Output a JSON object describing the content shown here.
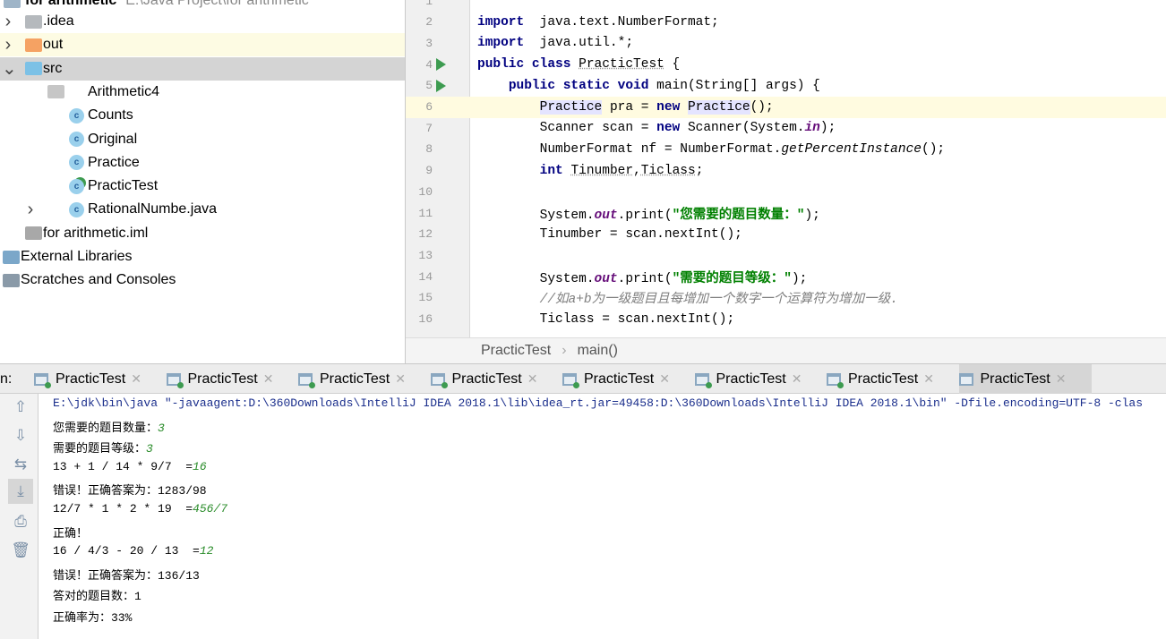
{
  "project": {
    "header": {
      "name": "for arithmetic",
      "path": "E:\\Java Project\\for arithmetic"
    },
    "items": [
      {
        "label": ".idea",
        "indent": 0,
        "expander": "chevron-right",
        "icon": "folder-gray",
        "state": ""
      },
      {
        "label": "out",
        "indent": 0,
        "expander": "chevron-right",
        "icon": "folder-orange",
        "state": "hl"
      },
      {
        "label": "src",
        "indent": 0,
        "expander": "chevron-down",
        "icon": "folder-blue",
        "state": "sel"
      },
      {
        "label": "Arithmetic4",
        "indent": 1,
        "expander": "",
        "icon": "package",
        "state": ""
      },
      {
        "label": "Counts",
        "indent": 1,
        "expander": "",
        "icon": "class",
        "state": ""
      },
      {
        "label": "Original",
        "indent": 1,
        "expander": "",
        "icon": "class",
        "state": ""
      },
      {
        "label": "Practice",
        "indent": 1,
        "expander": "",
        "icon": "class",
        "state": ""
      },
      {
        "label": "PracticTest",
        "indent": 1,
        "expander": "",
        "icon": "class-runnable",
        "state": ""
      },
      {
        "label": "RationalNumbe.java",
        "indent": 1,
        "expander": "chevron-right",
        "icon": "class",
        "state": ""
      },
      {
        "label": "for arithmetic.iml",
        "indent": 0,
        "expander": "",
        "icon": "iml-file",
        "state": ""
      },
      {
        "label": "External Libraries",
        "indent": -1,
        "expander": "",
        "icon": "libraries",
        "state": ""
      },
      {
        "label": "Scratches and Consoles",
        "indent": -1,
        "expander": "",
        "icon": "scratches",
        "state": ""
      }
    ]
  },
  "editor": {
    "current_line": 6,
    "lines": [
      {
        "n": "1",
        "run": false,
        "t": []
      },
      {
        "n": "2",
        "run": false,
        "t": [
          [
            "kw",
            "import"
          ],
          [
            "",
            "  java.text.NumberFormat;"
          ]
        ]
      },
      {
        "n": "3",
        "run": false,
        "t": [
          [
            "kw",
            "import"
          ],
          [
            "",
            "  java.util.*;"
          ]
        ]
      },
      {
        "n": "4",
        "run": true,
        "t": [
          [
            "kw",
            "public class"
          ],
          [
            "",
            " "
          ],
          [
            "ul",
            "PracticTest"
          ],
          [
            "",
            " {"
          ]
        ]
      },
      {
        "n": "5",
        "run": true,
        "t": [
          [
            "",
            "    "
          ],
          [
            "kw",
            "public static void"
          ],
          [
            "",
            " main(String[] args) {"
          ]
        ]
      },
      {
        "n": "6",
        "run": false,
        "t": [
          [
            "",
            "        "
          ],
          [
            "ref",
            "Practice"
          ],
          [
            "",
            " pra = "
          ],
          [
            "kw",
            "new"
          ],
          [
            "",
            " "
          ],
          [
            "ref",
            "Practice"
          ],
          [
            "",
            "();"
          ]
        ]
      },
      {
        "n": "7",
        "run": false,
        "t": [
          [
            "",
            "        Scanner scan = "
          ],
          [
            "kw",
            "new"
          ],
          [
            "",
            " Scanner(System."
          ],
          [
            "st",
            "in"
          ],
          [
            "",
            ");"
          ]
        ]
      },
      {
        "n": "8",
        "run": false,
        "t": [
          [
            "",
            "        NumberFormat nf = NumberFormat."
          ],
          [
            "it",
            "getPercentInstance"
          ],
          [
            "",
            "();"
          ]
        ]
      },
      {
        "n": "9",
        "run": false,
        "t": [
          [
            "",
            "        "
          ],
          [
            "kw",
            "int"
          ],
          [
            "",
            " "
          ],
          [
            "ul",
            "Tinumber"
          ],
          [
            "",
            ","
          ],
          [
            "ul",
            "Ticlass"
          ],
          [
            "",
            ";"
          ]
        ]
      },
      {
        "n": "10",
        "run": false,
        "t": []
      },
      {
        "n": "11",
        "run": false,
        "t": [
          [
            "",
            "        System."
          ],
          [
            "st",
            "out"
          ],
          [
            "",
            ".print("
          ],
          [
            "str",
            "\"您需要的题目数量：\""
          ],
          [
            "",
            ");"
          ]
        ]
      },
      {
        "n": "12",
        "run": false,
        "t": [
          [
            "",
            "        Tinumber = scan.nextInt();"
          ]
        ]
      },
      {
        "n": "13",
        "run": false,
        "t": []
      },
      {
        "n": "14",
        "run": false,
        "t": [
          [
            "",
            "        System."
          ],
          [
            "st",
            "out"
          ],
          [
            "",
            ".print("
          ],
          [
            "str",
            "\"需要的题目等级：\""
          ],
          [
            "",
            ");"
          ]
        ]
      },
      {
        "n": "15",
        "run": false,
        "t": [
          [
            "",
            "        "
          ],
          [
            "cm",
            "//如a+b为一级题目且每增加一个数字一个运算符为增加一级."
          ]
        ]
      },
      {
        "n": "16",
        "run": false,
        "t": [
          [
            "",
            "        Ticlass = scan.nextInt();"
          ]
        ]
      }
    ]
  },
  "breadcrumb": [
    "PracticTest",
    "main()"
  ],
  "run": {
    "label": "n:",
    "tabs": [
      "PracticTest",
      "PracticTest",
      "PracticTest",
      "PracticTest",
      "PracticTest",
      "PracticTest",
      "PracticTest",
      "PracticTest"
    ],
    "active_tab": 7,
    "toolbar": [
      {
        "name": "up-arrow-icon",
        "g": "⇧"
      },
      {
        "name": "down-arrow-icon",
        "g": "⇩"
      },
      {
        "name": "soft-wrap-icon",
        "g": "⇆"
      },
      {
        "name": "scroll-to-end-icon",
        "g": "⤓"
      },
      {
        "name": "print-icon",
        "g": "⎙"
      },
      {
        "name": "trash-icon",
        "g": "🗑"
      }
    ],
    "output": [
      [
        [
          "cmd",
          "E:\\jdk\\bin\\java \"-javaagent:D:\\360Downloads\\IntelliJ IDEA 2018.1\\lib\\idea_rt.jar=49458:D:\\360Downloads\\IntelliJ IDEA 2018.1\\bin\" -Dfile.encoding=UTF-8 -clas"
        ]
      ],
      [
        [
          "",
          "您需要的题目数量："
        ],
        [
          "in",
          "3"
        ]
      ],
      [
        [
          "",
          "需要的题目等级："
        ],
        [
          "in",
          "3"
        ]
      ],
      [
        [
          "",
          "13 + 1 / 14 * 9/7  ="
        ],
        [
          "in",
          "16"
        ]
      ],
      [
        [
          "",
          "错误！正确答案为：1283/98"
        ]
      ],
      [
        [
          "",
          "12/7 * 1 * 2 * 19  ="
        ],
        [
          "in",
          "456/7"
        ]
      ],
      [
        [
          "",
          "正确！"
        ]
      ],
      [
        [
          "",
          "16 / 4/3 - 20 / 13  ="
        ],
        [
          "in",
          "12"
        ]
      ],
      [
        [
          "",
          "错误！正确答案为：136/13"
        ]
      ],
      [
        [
          "",
          "答对的题目数：1"
        ]
      ],
      [
        [
          "",
          "正确率为：33%"
        ]
      ]
    ]
  },
  "colors": {
    "keyword": "#000080",
    "string": "#008000",
    "static_field": "#660e7a",
    "user_input": "#2a8c2a",
    "current_line": "#fffbe0",
    "selected_row": "#d4d4d4"
  }
}
